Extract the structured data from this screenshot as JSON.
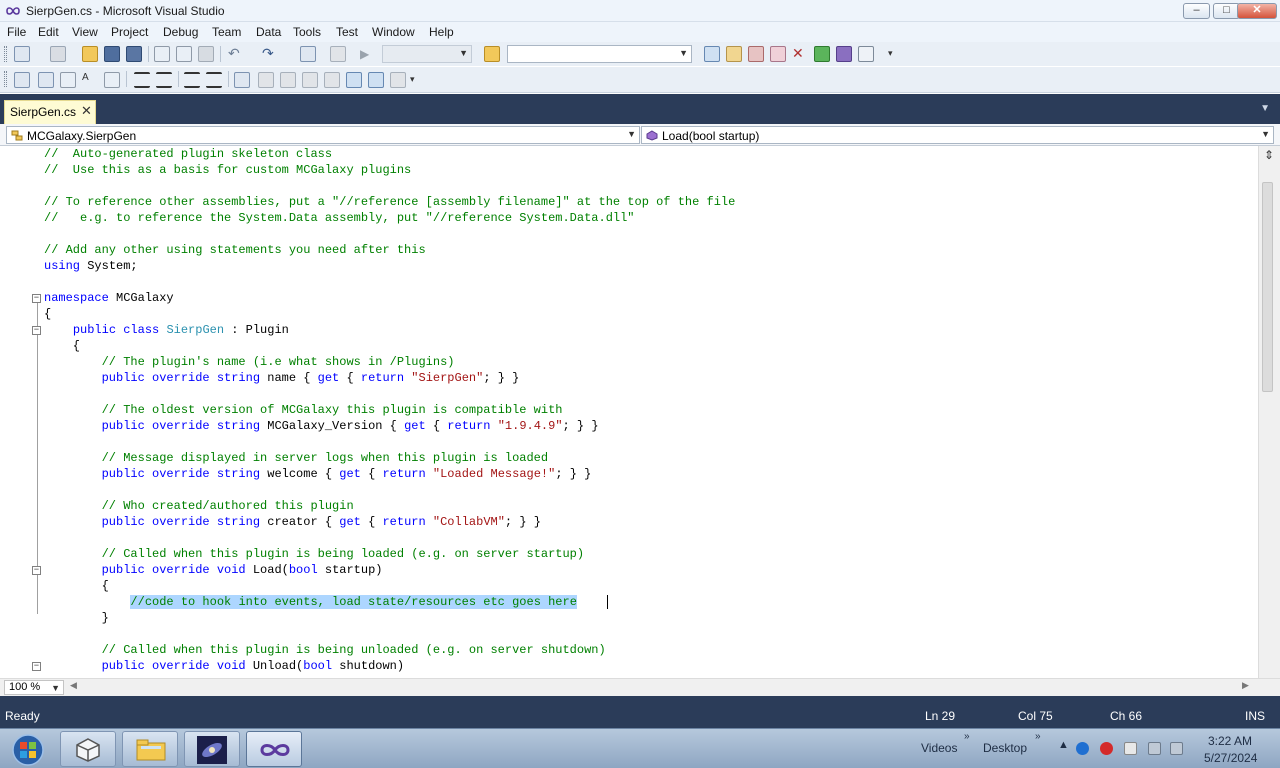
{
  "window": {
    "title": "SierpGen.cs - Microsoft Visual Studio",
    "controls": [
      "–",
      "□",
      "✕"
    ]
  },
  "menu": {
    "items": [
      "File",
      "Edit",
      "View",
      "Project",
      "Debug",
      "Team",
      "Data",
      "Tools",
      "Test",
      "Window",
      "Help"
    ]
  },
  "toolbar": {
    "icons": [
      "new-project-icon",
      "add-item-icon",
      "open-file-icon",
      "save-icon",
      "save-all-icon",
      "cut-icon",
      "copy-icon",
      "paste-icon",
      "undo-icon",
      "redo-icon",
      "navigate-backward-icon",
      "navigate-forward-icon",
      "start-debugging-icon",
      "find-in-files-icon",
      "solution-explorer-icon",
      "properties-icon",
      "object-browser-icon",
      "toolbox-icon",
      "start-page-icon",
      "extension-icon"
    ],
    "config_combo": "",
    "find_combo": ""
  },
  "tabs": [
    {
      "label": "SierpGen.cs",
      "close": "✕",
      "active": true
    }
  ],
  "navbar": {
    "type_combo": "MCGalaxy.SierpGen",
    "member_combo": "Load(bool startup)"
  },
  "code": {
    "lines": [
      [
        {
          "t": "//  Auto-generated plugin skeleton class",
          "c": "cm"
        }
      ],
      [
        {
          "t": "//  Use this as a basis for custom MCGalaxy plugins",
          "c": "cm"
        }
      ],
      [],
      [
        {
          "t": "// To reference other assemblies, put a \"//reference [assembly filename]\" at the top of the file",
          "c": "cm"
        }
      ],
      [
        {
          "t": "//   e.g. to reference the System.Data assembly, put \"//reference System.Data.dll\"",
          "c": "cm"
        }
      ],
      [],
      [
        {
          "t": "// Add any other using statements you need after this",
          "c": "cm"
        }
      ],
      [
        {
          "t": "using",
          "c": "kw"
        },
        {
          "t": " System;"
        }
      ],
      [],
      [
        {
          "t": "namespace",
          "c": "kw"
        },
        {
          "t": " MCGalaxy"
        }
      ],
      [
        {
          "t": "{"
        }
      ],
      [
        {
          "t": "    "
        },
        {
          "t": "public class",
          "c": "kw"
        },
        {
          "t": " "
        },
        {
          "t": "SierpGen",
          "c": "ty"
        },
        {
          "t": " : Plugin"
        }
      ],
      [
        {
          "t": "    {"
        }
      ],
      [
        {
          "t": "        "
        },
        {
          "t": "// The plugin's name (i.e what shows in /Plugins)",
          "c": "cm"
        }
      ],
      [
        {
          "t": "        "
        },
        {
          "t": "public override string",
          "c": "kw"
        },
        {
          "t": " name { "
        },
        {
          "t": "get",
          "c": "kw"
        },
        {
          "t": " { "
        },
        {
          "t": "return",
          "c": "kw"
        },
        {
          "t": " "
        },
        {
          "t": "\"SierpGen\"",
          "c": "str"
        },
        {
          "t": "; } }"
        }
      ],
      [],
      [
        {
          "t": "        "
        },
        {
          "t": "// The oldest version of MCGalaxy this plugin is compatible with",
          "c": "cm"
        }
      ],
      [
        {
          "t": "        "
        },
        {
          "t": "public override string",
          "c": "kw"
        },
        {
          "t": " MCGalaxy_Version { "
        },
        {
          "t": "get",
          "c": "kw"
        },
        {
          "t": " { "
        },
        {
          "t": "return",
          "c": "kw"
        },
        {
          "t": " "
        },
        {
          "t": "\"1.9.4.9\"",
          "c": "str"
        },
        {
          "t": "; } }"
        }
      ],
      [],
      [
        {
          "t": "        "
        },
        {
          "t": "// Message displayed in server logs when this plugin is loaded",
          "c": "cm"
        }
      ],
      [
        {
          "t": "        "
        },
        {
          "t": "public override string",
          "c": "kw"
        },
        {
          "t": " welcome { "
        },
        {
          "t": "get",
          "c": "kw"
        },
        {
          "t": " { "
        },
        {
          "t": "return",
          "c": "kw"
        },
        {
          "t": " "
        },
        {
          "t": "\"Loaded Message!\"",
          "c": "str"
        },
        {
          "t": "; } }"
        }
      ],
      [],
      [
        {
          "t": "        "
        },
        {
          "t": "// Who created/authored this plugin",
          "c": "cm"
        }
      ],
      [
        {
          "t": "        "
        },
        {
          "t": "public override string",
          "c": "kw"
        },
        {
          "t": " creator { "
        },
        {
          "t": "get",
          "c": "kw"
        },
        {
          "t": " { "
        },
        {
          "t": "return",
          "c": "kw"
        },
        {
          "t": " "
        },
        {
          "t": "\"CollabVM\"",
          "c": "str"
        },
        {
          "t": "; } }"
        }
      ],
      [],
      [
        {
          "t": "        "
        },
        {
          "t": "// Called when this plugin is being loaded (e.g. on server startup)",
          "c": "cm"
        }
      ],
      [
        {
          "t": "        "
        },
        {
          "t": "public override void",
          "c": "kw"
        },
        {
          "t": " Load("
        },
        {
          "t": "bool",
          "c": "kw"
        },
        {
          "t": " startup)"
        }
      ],
      [
        {
          "t": "        {"
        }
      ],
      [
        {
          "t": "            "
        },
        {
          "t": "//code to hook into events, load state/resources etc goes here",
          "c": "cm sel"
        }
      ],
      [
        {
          "t": "        }"
        }
      ],
      [],
      [
        {
          "t": "        "
        },
        {
          "t": "// Called when this plugin is being unloaded (e.g. on server shutdown)",
          "c": "cm"
        }
      ],
      [
        {
          "t": "        "
        },
        {
          "t": "public override void",
          "c": "kw"
        },
        {
          "t": " Unload("
        },
        {
          "t": "bool",
          "c": "kw"
        },
        {
          "t": " shutdown)"
        }
      ]
    ],
    "collapse_markers": [
      "−",
      "−",
      "−",
      "−"
    ]
  },
  "editor_footer": {
    "zoom": "100 %"
  },
  "status": {
    "ready": "Ready",
    "ln": "Ln 29",
    "col": "Col 75",
    "ch": "Ch 66",
    "mode": "INS"
  },
  "taskbar": {
    "videos": "Videos",
    "desktop": "Desktop",
    "time": "3:22 AM",
    "date": "5/27/2024"
  },
  "colors": {
    "accent": "#2b3c59",
    "keyword": "#0000ff",
    "comment": "#008000",
    "string": "#a31515",
    "type": "#2b91af",
    "selection": "#add6ff"
  }
}
